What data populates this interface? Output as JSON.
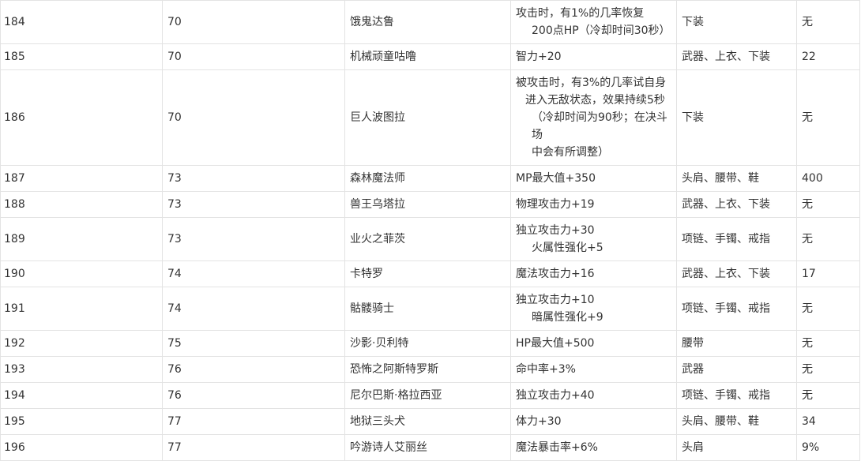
{
  "rows": [
    {
      "id": "184",
      "level": "70",
      "name": "饿鬼达鲁",
      "effect": [
        "攻击时，有1%的几率恢复",
        "200点HP（冷却时间30秒）"
      ],
      "slots": "下装",
      "extra": "无"
    },
    {
      "id": "185",
      "level": "70",
      "name": "机械顽童咕噜",
      "effect": [
        "智力+20"
      ],
      "slots": "武器、上衣、下装",
      "extra": "22"
    },
    {
      "id": "186",
      "level": "70",
      "name": "巨人波图拉",
      "effect": [
        "被攻击时，有3%的几率试自身",
        "进入无敌状态，效果持续5秒",
        "（冷却时间为90秒；在决斗场",
        "中会有所调整）"
      ],
      "slots": "下装",
      "extra": "无"
    },
    {
      "id": "187",
      "level": "73",
      "name": "森林魔法师",
      "effect": [
        "MP最大值+350"
      ],
      "slots": "头肩、腰带、鞋",
      "extra": "400"
    },
    {
      "id": "188",
      "level": "73",
      "name": "兽王乌塔拉",
      "effect": [
        "物理攻击力+19"
      ],
      "slots": "武器、上衣、下装",
      "extra": "无"
    },
    {
      "id": "189",
      "level": "73",
      "name": "业火之菲茨",
      "effect": [
        "独立攻击力+30",
        "火属性强化+5"
      ],
      "slots": "项链、手镯、戒指",
      "extra": "无"
    },
    {
      "id": "190",
      "level": "74",
      "name": "卡特罗",
      "effect": [
        "魔法攻击力+16"
      ],
      "slots": "武器、上衣、下装",
      "extra": "17"
    },
    {
      "id": "191",
      "level": "74",
      "name": "骷髅骑士",
      "effect": [
        "独立攻击力+10",
        "暗属性强化+9"
      ],
      "slots": "项链、手镯、戒指",
      "extra": "无"
    },
    {
      "id": "192",
      "level": "75",
      "name": "沙影·贝利特",
      "effect": [
        "HP最大值+500"
      ],
      "slots": "腰带",
      "extra": "无"
    },
    {
      "id": "193",
      "level": "76",
      "name": "恐怖之阿斯特罗斯",
      "effect": [
        "命中率+3%"
      ],
      "slots": "武器",
      "extra": "无"
    },
    {
      "id": "194",
      "level": "76",
      "name": "尼尔巴斯·格拉西亚",
      "effect": [
        "独立攻击力+40"
      ],
      "slots": "项链、手镯、戒指",
      "extra": "无"
    },
    {
      "id": "195",
      "level": "77",
      "name": "地狱三头犬",
      "effect": [
        "体力+30"
      ],
      "slots": "头肩、腰带、鞋",
      "extra": "34"
    },
    {
      "id": "196",
      "level": "77",
      "name": "吟游诗人艾丽丝",
      "effect": [
        "魔法暴击率+6%"
      ],
      "slots": "头肩",
      "extra": "9%"
    }
  ]
}
